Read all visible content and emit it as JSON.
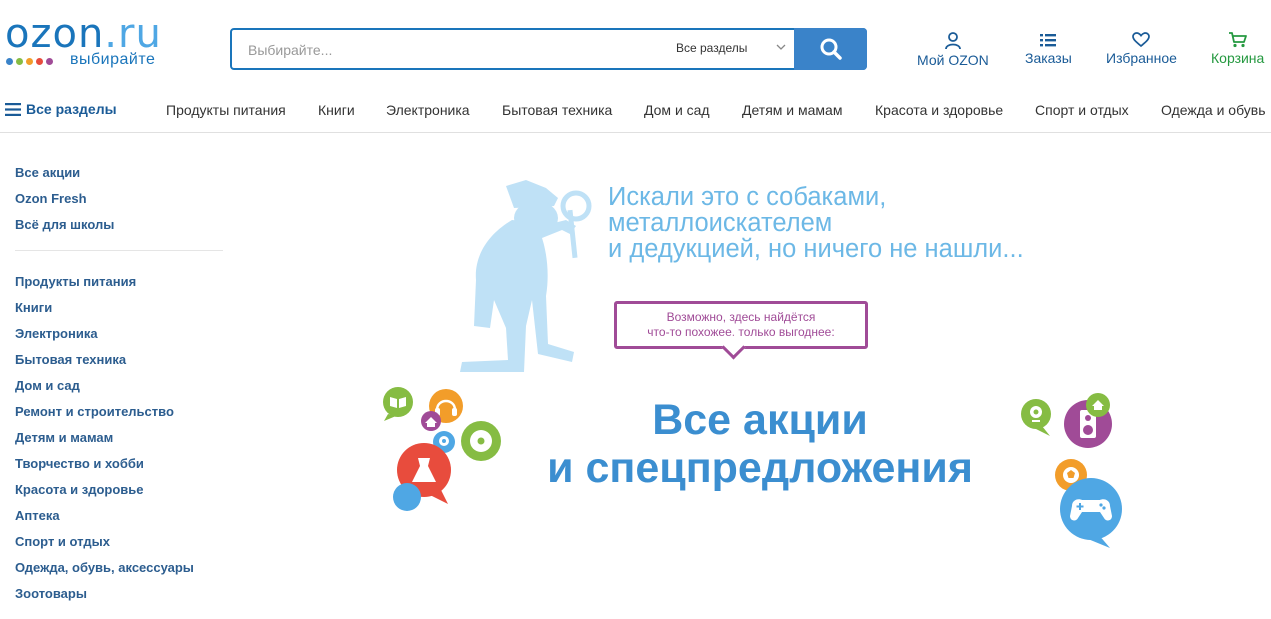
{
  "header": {
    "logo": {
      "word": "ozon",
      "tld": ".ru",
      "tagline": "выбирайте",
      "dot_colors": [
        "#3a83c9",
        "#86bc43",
        "#f29d2a",
        "#e84c3d",
        "#a04b97"
      ]
    },
    "search": {
      "placeholder": "Выбирайте...",
      "scope": "Все разделы",
      "button_icon": "search-icon"
    },
    "links": {
      "account": "Мой OZON",
      "orders": "Заказы",
      "favorites": "Избранное",
      "cart": "Корзина"
    },
    "colors": {
      "brand": "#1a75bb",
      "cart": "#259940"
    }
  },
  "nav": {
    "all_label": "Все разделы",
    "categories": [
      "Продукты питания",
      "Книги",
      "Электроника",
      "Бытовая техника",
      "Дом и сад",
      "Детям и мамам",
      "Красота и здоровье",
      "Спорт и отдых",
      "Одежда и обувь"
    ]
  },
  "sidebar": {
    "promo_links": [
      "Все акции",
      "Ozon Fresh",
      "Всё для школы"
    ],
    "categories": [
      "Продукты питания",
      "Книги",
      "Электроника",
      "Бытовая техника",
      "Дом и сад",
      "Ремонт и строительство",
      "Детям и мамам",
      "Творчество и хобби",
      "Красота и здоровье",
      "Аптека",
      "Спорт и отдых",
      "Одежда, обувь, аксессуары",
      "Зоотовары"
    ]
  },
  "banner": {
    "headline": [
      "Искали это с собаками,",
      "металлоискателем",
      "и дедукцией, но ничего не нашли..."
    ],
    "bubble": [
      "Возможно, здесь найдётся",
      "что-то похожее, только выгоднее:"
    ],
    "promo": [
      "Все акции",
      "и спецпредложения"
    ],
    "icons": [
      "detective-illustration",
      "book-icon",
      "headphones-icon",
      "cd-icon",
      "home-icon",
      "webcam-icon",
      "speaker-icon",
      "ball-icon",
      "gamepad-icon"
    ]
  }
}
